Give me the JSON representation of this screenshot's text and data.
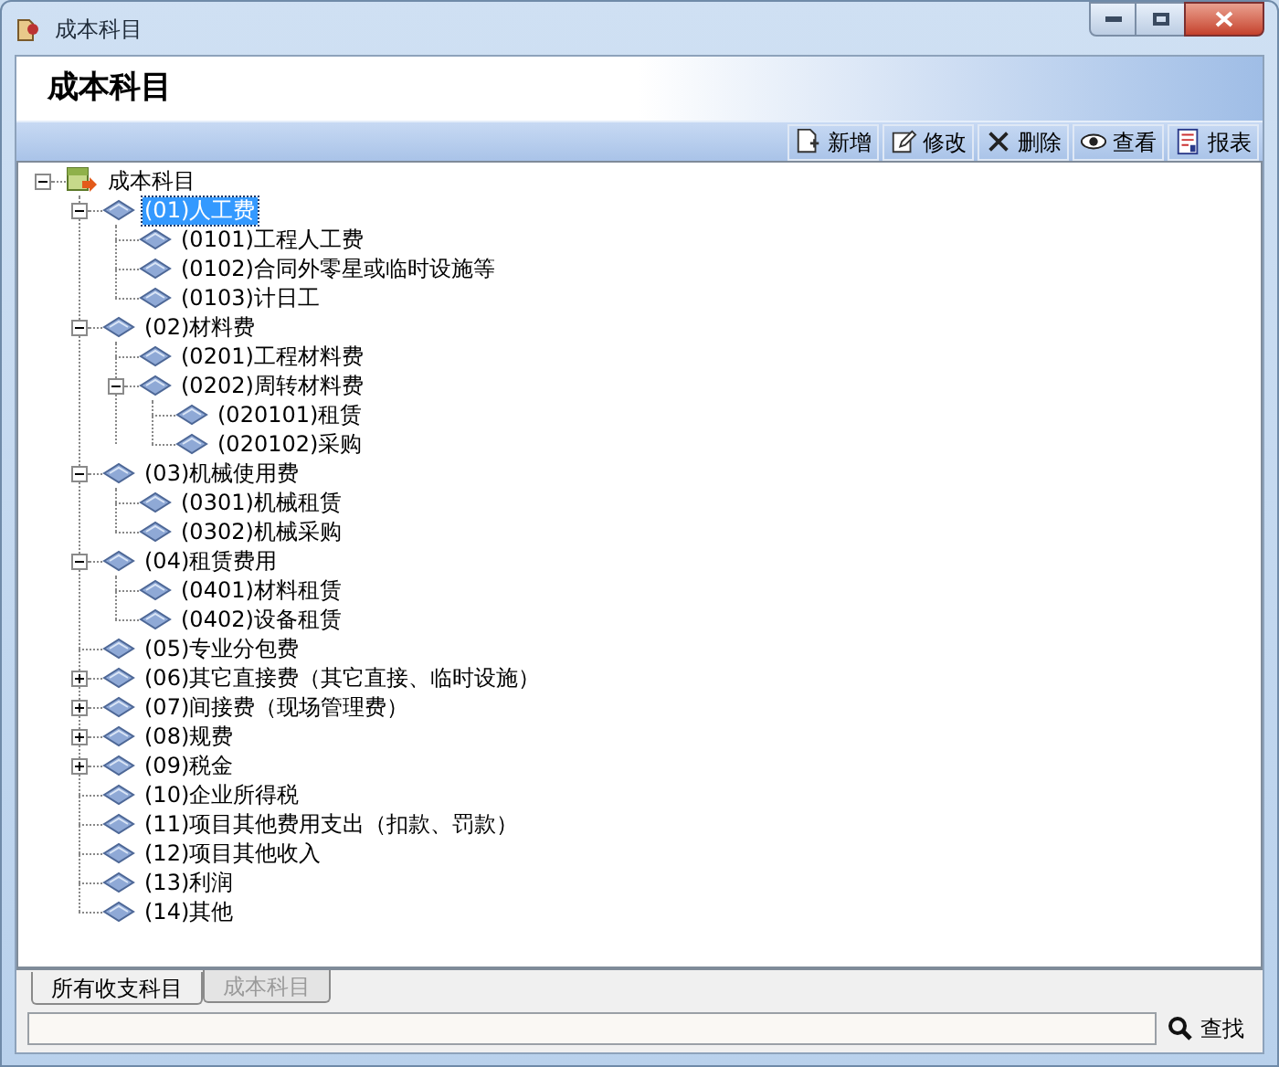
{
  "window": {
    "title": "成本科目"
  },
  "header": {
    "title": "成本科目"
  },
  "toolbar": [
    {
      "kind": "add",
      "label": "新增"
    },
    {
      "kind": "edit",
      "label": "修改"
    },
    {
      "kind": "delete",
      "label": "删除"
    },
    {
      "kind": "view",
      "label": "查看"
    },
    {
      "kind": "report",
      "label": "报表"
    }
  ],
  "tree": {
    "label": "成本科目",
    "expanded": true,
    "selected": false,
    "children": [
      {
        "label": "(01)人工费",
        "expanded": true,
        "selected": true,
        "children": [
          {
            "label": "(0101)工程人工费",
            "selected": false
          },
          {
            "label": "(0102)合同外零星或临时设施等",
            "selected": false
          },
          {
            "label": "(0103)计日工",
            "selected": false
          }
        ]
      },
      {
        "label": "(02)材料费",
        "expanded": true,
        "selected": false,
        "children": [
          {
            "label": "(0201)工程材料费",
            "selected": false
          },
          {
            "label": "(0202)周转材料费",
            "expanded": true,
            "selected": false,
            "children": [
              {
                "label": "(020101)租赁",
                "selected": false
              },
              {
                "label": "(020102)采购",
                "selected": false
              }
            ]
          }
        ]
      },
      {
        "label": "(03)机械使用费",
        "expanded": true,
        "selected": false,
        "children": [
          {
            "label": "(0301)机械租赁",
            "selected": false
          },
          {
            "label": "(0302)机械采购",
            "selected": false
          }
        ]
      },
      {
        "label": "(04)租赁费用",
        "expanded": true,
        "selected": false,
        "children": [
          {
            "label": "(0401)材料租赁",
            "selected": false
          },
          {
            "label": "(0402)设备租赁",
            "selected": false
          }
        ]
      },
      {
        "label": "(05)专业分包费",
        "selected": false
      },
      {
        "label": "(06)其它直接费（其它直接、临时设施）",
        "expanded": false,
        "selected": false
      },
      {
        "label": "(07)间接费（现场管理费）",
        "expanded": false,
        "selected": false
      },
      {
        "label": "(08)规费",
        "expanded": false,
        "selected": false
      },
      {
        "label": "(09)税金",
        "expanded": false,
        "selected": false
      },
      {
        "label": "(10)企业所得税",
        "selected": false
      },
      {
        "label": "(11)项目其他费用支出（扣款、罚款）",
        "selected": false
      },
      {
        "label": "(12)项目其他收入",
        "selected": false
      },
      {
        "label": "(13)利润",
        "selected": false
      },
      {
        "label": "(14)其他",
        "selected": false
      }
    ]
  },
  "tabs": [
    {
      "label": "所有收支科目",
      "selected": true
    },
    {
      "label": "成本科目",
      "selected": false
    }
  ],
  "search": {
    "button": "查找"
  }
}
